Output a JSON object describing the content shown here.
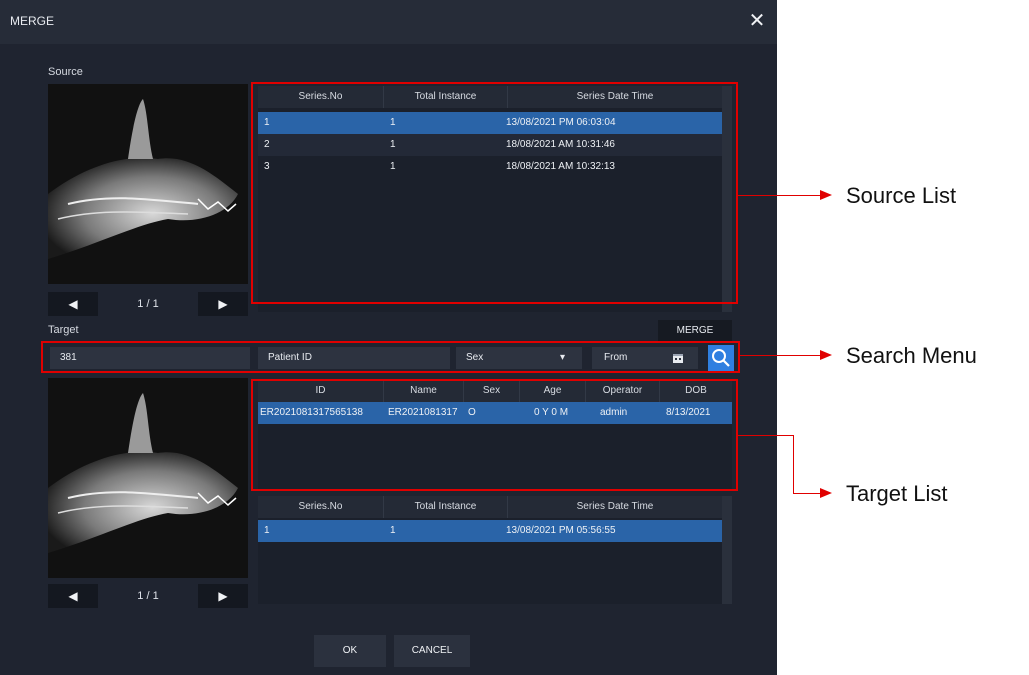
{
  "dialog": {
    "title": "MERGE",
    "close_icon": "✕"
  },
  "source": {
    "label": "Source",
    "pager": {
      "prev_icon": "◀",
      "page": "1 / 1",
      "next_icon": "▶"
    },
    "columns": [
      "Series.No",
      "Total Instance",
      "Series Date Time"
    ],
    "rows": [
      [
        "1",
        "1",
        "13/08/2021 PM 06:03:04"
      ],
      [
        "2",
        "1",
        "18/08/2021 AM 10:31:46"
      ],
      [
        "3",
        "1",
        "18/08/2021 AM 10:32:13"
      ]
    ],
    "selected_row": 0
  },
  "target": {
    "label": "Target",
    "merge_button": "MERGE",
    "search": {
      "value": "381",
      "patient_id_placeholder": "Patient ID",
      "sex": "Sex",
      "sex_dropdown_icon": "▾",
      "from": "From",
      "calendar_icon": "calendar-icon",
      "search_icon": "search-icon"
    },
    "pager": {
      "prev_icon": "◀",
      "page": "1 / 1",
      "next_icon": "▶"
    },
    "patient_columns": [
      "ID",
      "Name",
      "Sex",
      "Age",
      "Operator",
      "DOB"
    ],
    "patient_rows": [
      [
        "ER2021081317565138",
        "ER2021081317",
        "O",
        "0 Y 0 M",
        "admin",
        "8/13/2021"
      ]
    ],
    "series_columns": [
      "Series.No",
      "Total Instance",
      "Series Date Time"
    ],
    "series_rows": [
      [
        "1",
        "1",
        "13/08/2021 PM 05:56:55"
      ]
    ]
  },
  "footer": {
    "ok": "OK",
    "cancel": "CANCEL"
  },
  "callouts": {
    "source_list": "Source List",
    "search_menu": "Search Menu",
    "target_list": "Target List"
  },
  "colors": {
    "dialog_bg": "#1f2430",
    "selected_row": "#2a64a8",
    "search_button": "#2f7fe0",
    "annotation_red": "#e00000"
  }
}
